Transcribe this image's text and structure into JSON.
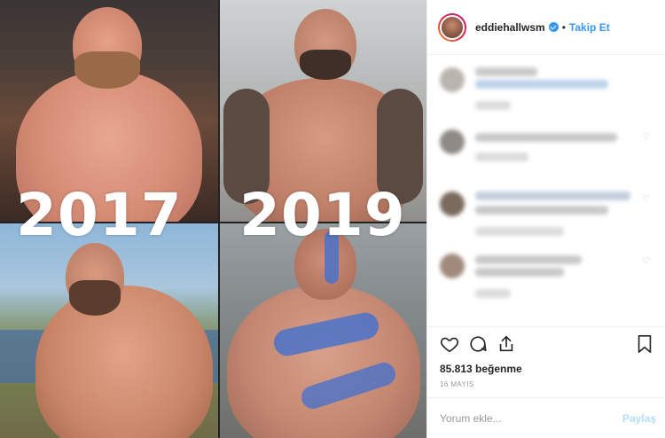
{
  "collage": {
    "year_left": "2017",
    "year_right": "2019"
  },
  "header": {
    "username": "eddiehallwsm",
    "separator": "•",
    "follow_label": "Takip Et",
    "verified_color": "#3897f0"
  },
  "actions": {
    "like_icon": "heart-icon",
    "comment_icon": "comment-icon",
    "share_icon": "share-icon",
    "save_icon": "bookmark-icon",
    "likes_text": "85.813 beğenme",
    "date_text": "16 MAYIS"
  },
  "add_comment": {
    "placeholder": "Yorum ekle...",
    "post_label": "Paylaş"
  },
  "colors": {
    "accent": "#3897f0",
    "post_button_disabled": "#b2dffc"
  }
}
